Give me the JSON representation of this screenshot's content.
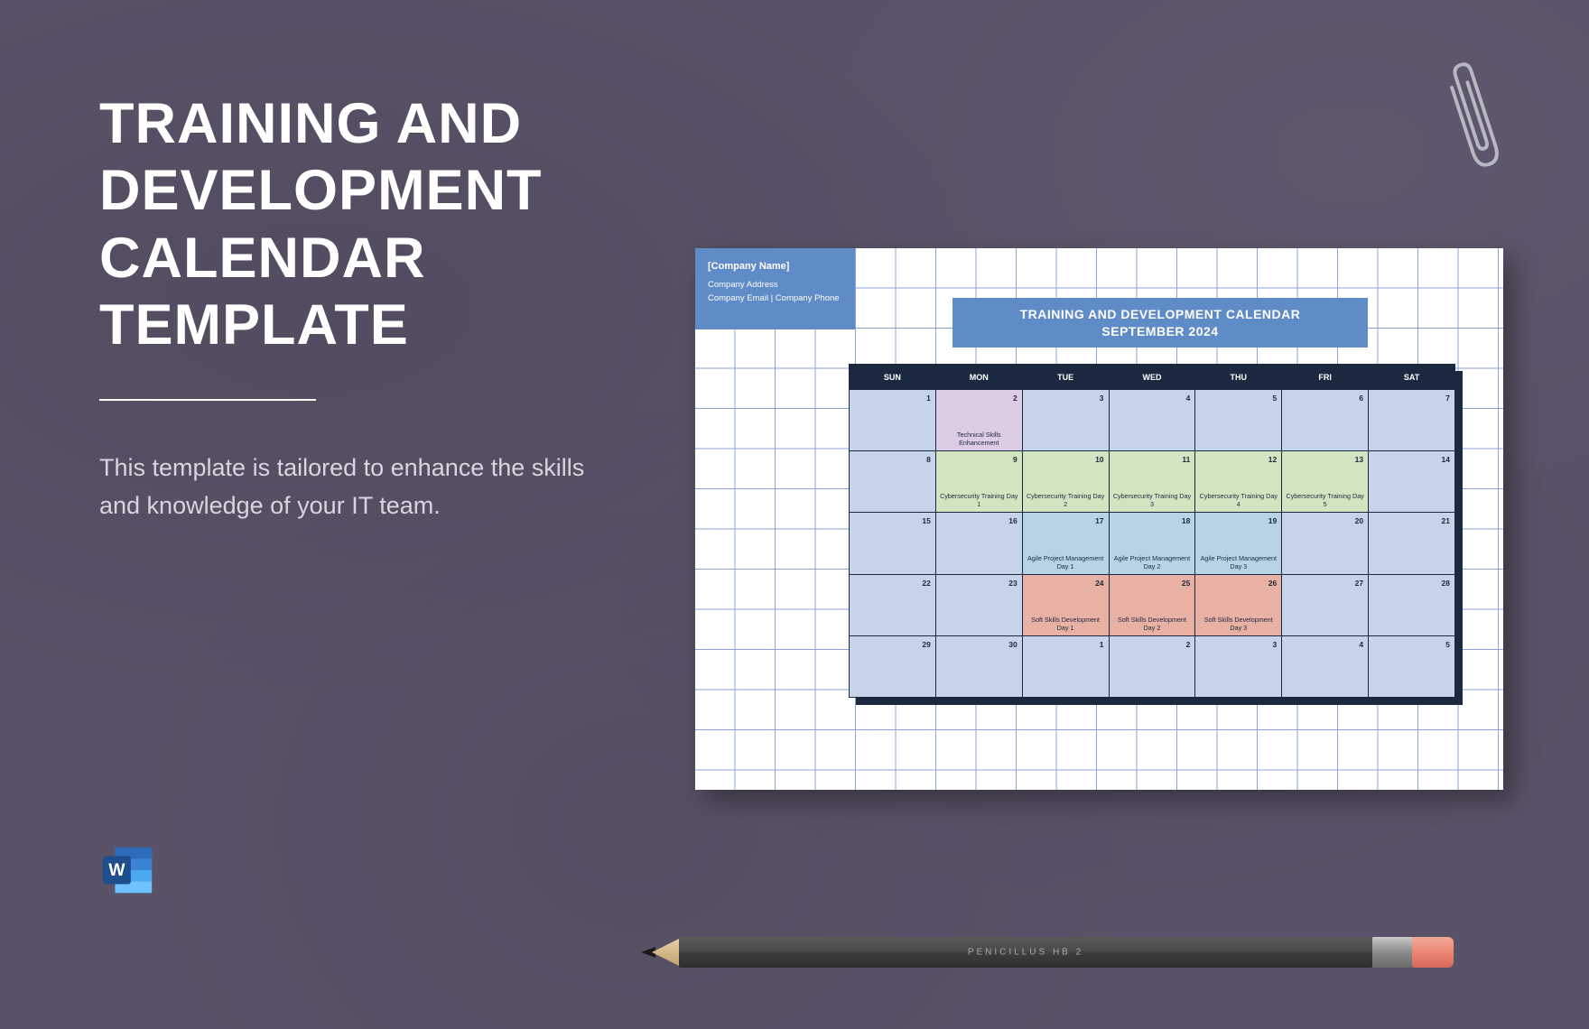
{
  "title": "TRAINING AND\nDEVELOPMENT\nCALENDAR\nTEMPLATE",
  "description": "This template is tailored to enhance the skills and knowledge of your IT team.",
  "pencil_label": "PENICILLUS   HB 2",
  "preview": {
    "company": {
      "name": "[Company Name]",
      "address": "Company Address",
      "contact": "Company Email | Company Phone"
    },
    "calendar_title_line1": "TRAINING AND DEVELOPMENT CALENDAR",
    "calendar_title_line2": "SEPTEMBER 2024",
    "days": [
      "SUN",
      "MON",
      "TUE",
      "WED",
      "THU",
      "FRI",
      "SAT"
    ],
    "weeks": [
      [
        {
          "n": "1",
          "evt": "",
          "cls": ""
        },
        {
          "n": "2",
          "evt": "Technical Skills Enhancement",
          "cls": "c-purple"
        },
        {
          "n": "3",
          "evt": "",
          "cls": ""
        },
        {
          "n": "4",
          "evt": "",
          "cls": ""
        },
        {
          "n": "5",
          "evt": "",
          "cls": ""
        },
        {
          "n": "6",
          "evt": "",
          "cls": ""
        },
        {
          "n": "7",
          "evt": "",
          "cls": ""
        }
      ],
      [
        {
          "n": "8",
          "evt": "",
          "cls": ""
        },
        {
          "n": "9",
          "evt": "Cybersecurity Training Day 1",
          "cls": "c-green"
        },
        {
          "n": "10",
          "evt": "Cybersecurity Training Day 2",
          "cls": "c-green"
        },
        {
          "n": "11",
          "evt": "Cybersecurity Training Day 3",
          "cls": "c-green"
        },
        {
          "n": "12",
          "evt": "Cybersecurity Training Day 4",
          "cls": "c-green"
        },
        {
          "n": "13",
          "evt": "Cybersecurity Training Day 5",
          "cls": "c-green"
        },
        {
          "n": "14",
          "evt": "",
          "cls": ""
        }
      ],
      [
        {
          "n": "15",
          "evt": "",
          "cls": ""
        },
        {
          "n": "16",
          "evt": "",
          "cls": ""
        },
        {
          "n": "17",
          "evt": "Agile Project Management Day 1",
          "cls": "c-teal"
        },
        {
          "n": "18",
          "evt": "Agile Project Management Day 2",
          "cls": "c-teal"
        },
        {
          "n": "19",
          "evt": "Agile Project Management Day 3",
          "cls": "c-teal"
        },
        {
          "n": "20",
          "evt": "",
          "cls": ""
        },
        {
          "n": "21",
          "evt": "",
          "cls": ""
        }
      ],
      [
        {
          "n": "22",
          "evt": "",
          "cls": ""
        },
        {
          "n": "23",
          "evt": "",
          "cls": ""
        },
        {
          "n": "24",
          "evt": "Soft Skills Development Day 1",
          "cls": "c-salmon"
        },
        {
          "n": "25",
          "evt": "Soft Skills Development Day 2",
          "cls": "c-salmon"
        },
        {
          "n": "26",
          "evt": "Soft Skills Development Day 3",
          "cls": "c-salmon"
        },
        {
          "n": "27",
          "evt": "",
          "cls": ""
        },
        {
          "n": "28",
          "evt": "",
          "cls": ""
        }
      ],
      [
        {
          "n": "29",
          "evt": "",
          "cls": ""
        },
        {
          "n": "30",
          "evt": "",
          "cls": ""
        },
        {
          "n": "1",
          "evt": "",
          "cls": ""
        },
        {
          "n": "2",
          "evt": "",
          "cls": ""
        },
        {
          "n": "3",
          "evt": "",
          "cls": ""
        },
        {
          "n": "4",
          "evt": "",
          "cls": ""
        },
        {
          "n": "5",
          "evt": "",
          "cls": ""
        }
      ]
    ]
  }
}
